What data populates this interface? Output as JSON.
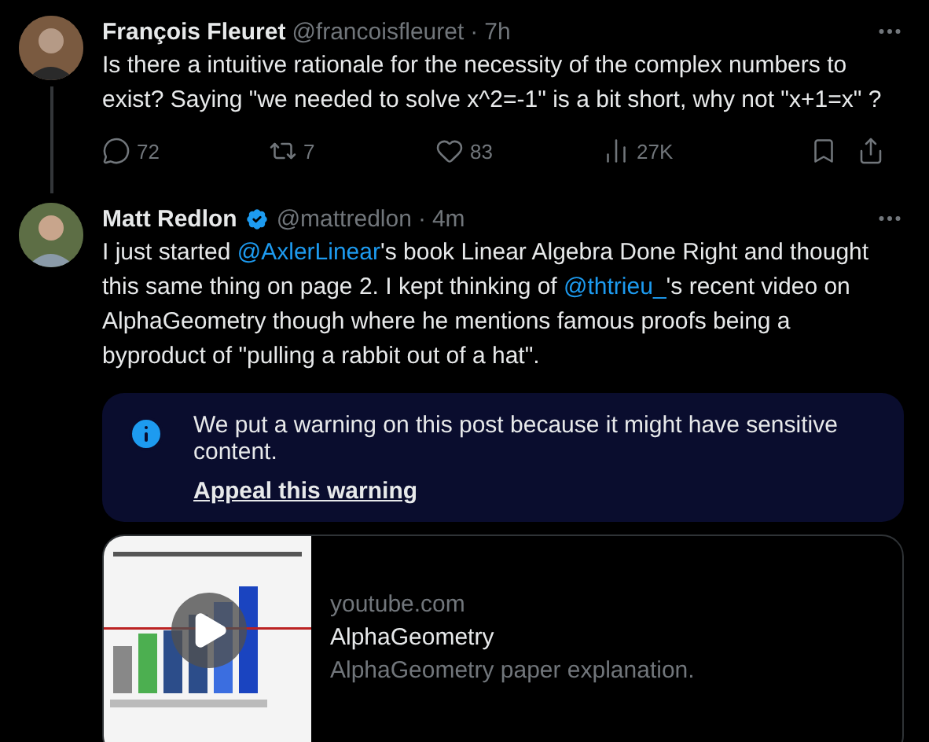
{
  "posts": [
    {
      "author": "François Fleuret",
      "handle": "@francoisfleuret",
      "separator": "·",
      "time": "7h",
      "thread_line": true,
      "text": "Is there a intuitive rationale for the necessity of the complex numbers to exist? Saying \"we needed to solve x^2=-1\" is a bit short, why not \"x+1=x\" ?",
      "actions": [
        {
          "kind": "reply",
          "count": "72"
        },
        {
          "kind": "repost",
          "count": "7"
        },
        {
          "kind": "like",
          "count": "83"
        },
        {
          "kind": "views",
          "count": "27K"
        },
        {
          "kind": "bookmark"
        },
        {
          "kind": "share"
        }
      ]
    },
    {
      "author": "Matt Redlon",
      "handle": "@mattredlon",
      "separator": "·",
      "time": "4m",
      "verified": true,
      "thread_line": false,
      "segments": [
        {
          "kind": "text",
          "text": "I just started "
        },
        {
          "kind": "mention",
          "text": "@AxlerLinear"
        },
        {
          "kind": "text",
          "text": "'s book Linear Algebra Done Right and thought this same thing on page 2. I kept thinking of "
        },
        {
          "kind": "mention",
          "text": "@thtrieu_"
        },
        {
          "kind": "text",
          "text": "'s recent video on AlphaGeometry though where he mentions famous proofs being a byproduct of \"pulling a rabbit out of a hat\"."
        }
      ],
      "warning": {
        "message": "We put a warning on this post because it might have sensitive content.",
        "link": "Appeal this warning"
      },
      "card": {
        "domain": "youtube.com",
        "title": "AlphaGeometry",
        "description": "AlphaGeometry paper explanation."
      }
    }
  ]
}
